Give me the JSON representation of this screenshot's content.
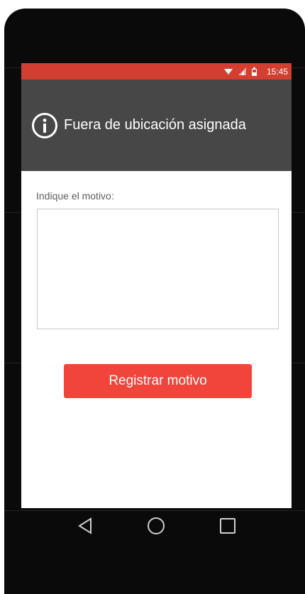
{
  "status_bar": {
    "time": "15:45",
    "color": "#d23f31",
    "icons": [
      "wifi-icon",
      "signal-icon",
      "battery-icon"
    ]
  },
  "header": {
    "icon": "info-icon",
    "title": "Fuera de ubicación asignada",
    "background": "#474747"
  },
  "form": {
    "label": "Indique el motivo:",
    "textarea_value": "",
    "submit_label": "Registrar motivo",
    "submit_color": "#f1443a"
  },
  "navbar": {
    "buttons": [
      "back-icon",
      "home-icon",
      "recents-icon"
    ]
  }
}
